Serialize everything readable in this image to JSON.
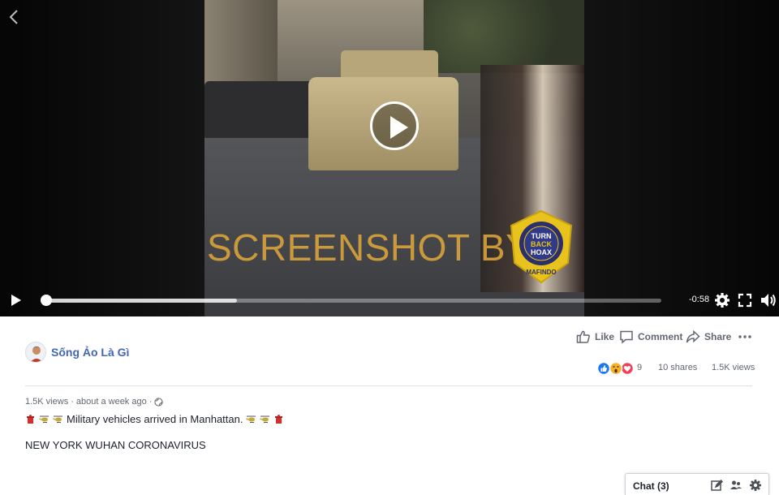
{
  "video": {
    "watermark_text": "SCREENSHOT BY",
    "badge": {
      "center_text_lines": [
        "TURN",
        "BACK",
        "HOAX"
      ],
      "ring_text": "MASYARAKAT ANTI FITNAH INDONESIA",
      "bottom_text": "MAFINDO"
    },
    "remaining_time": "-0:58",
    "progress_fraction": 0.0,
    "buffered_fraction": 0.31
  },
  "post_actions": {
    "like": "Like",
    "comment": "Comment",
    "share": "Share"
  },
  "page": {
    "name": "Sống Ảo Là Gì"
  },
  "stats": {
    "reaction_count": "9",
    "shares": "10 shares",
    "views": "1.5K views"
  },
  "meta": {
    "views": "1.5K views",
    "separator1": "·",
    "time": "about a week ago",
    "separator2": "·"
  },
  "message": {
    "text": "Military vehicles arrived in Manhattan.",
    "hashtags": "NEW YORK WUHAN CORONAVIRUS"
  },
  "chat": {
    "label": "Chat (3)"
  },
  "colors": {
    "link_blue": "#4267b2",
    "like_blue": "#1877f2",
    "love_red": "#f33e58",
    "wow_yellow": "#f7b125",
    "watermark_orange": "#d9a33a"
  },
  "icons": [
    "back-arrow-icon",
    "play-icon",
    "settings-gear-icon",
    "fullscreen-icon",
    "volume-icon",
    "like-icon",
    "comment-icon",
    "share-icon",
    "more-icon",
    "globe-icon",
    "compose-icon",
    "group-chat-icon",
    "chat-settings-icon"
  ]
}
